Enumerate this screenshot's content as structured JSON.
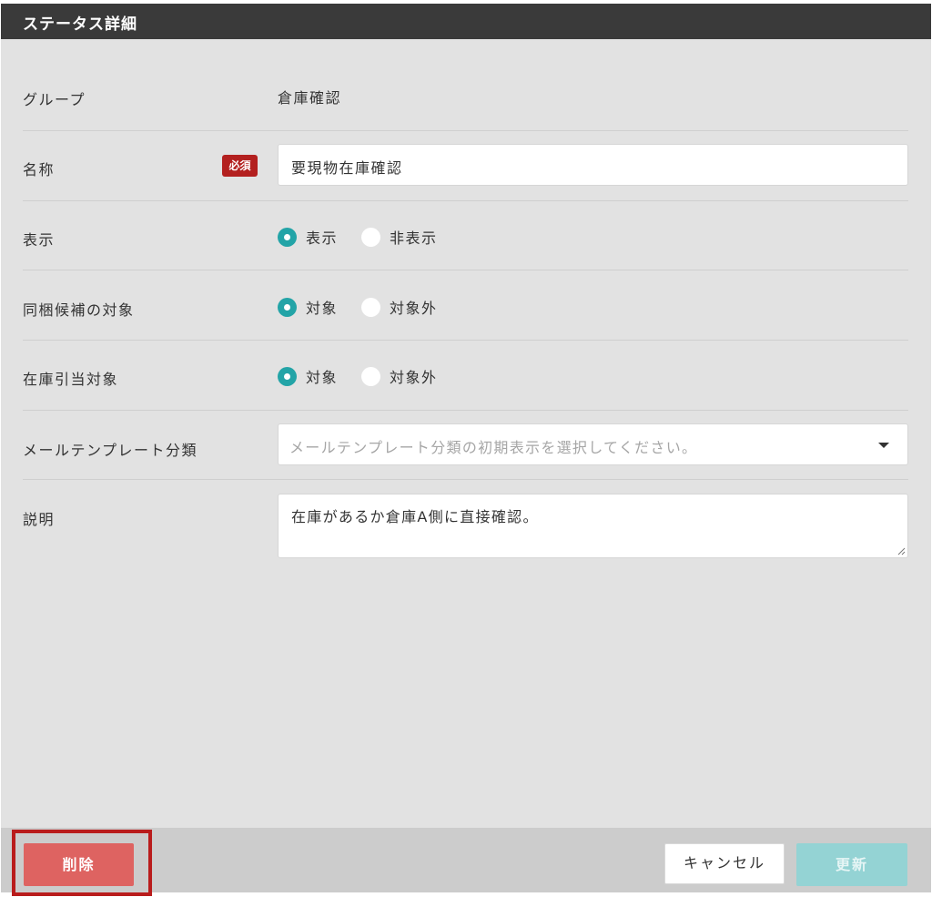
{
  "dialog": {
    "title": "ステータス詳細"
  },
  "form": {
    "group": {
      "label": "グループ",
      "value": "倉庫確認"
    },
    "name": {
      "label": "名称",
      "required_badge": "必須",
      "value": "要現物在庫確認"
    },
    "display": {
      "label": "表示",
      "options": [
        "表示",
        "非表示"
      ],
      "selected": "表示"
    },
    "bundle_target": {
      "label": "同梱候補の対象",
      "options": [
        "対象",
        "対象外"
      ],
      "selected": "対象"
    },
    "stock_allocation": {
      "label": "在庫引当対象",
      "options": [
        "対象",
        "対象外"
      ],
      "selected": "対象"
    },
    "mail_template": {
      "label": "メールテンプレート分類",
      "placeholder": "メールテンプレート分類の初期表示を選択してください。"
    },
    "description": {
      "label": "説明",
      "value": "在庫があるか倉庫A側に直接確認。"
    }
  },
  "footer": {
    "delete_label": "削除",
    "cancel_label": "キャンセル",
    "update_label": "更新"
  },
  "colors": {
    "header_bg": "#3a3a3a",
    "accent_teal": "#23a4a7",
    "required_red": "#b3201f",
    "delete_red": "#de6361",
    "update_disabled": "#94d3d4",
    "highlight_border": "#b91c1c"
  },
  "icons": {
    "select_caret": "chevron-down-icon",
    "resize_grip": "resize-grip-icon"
  }
}
